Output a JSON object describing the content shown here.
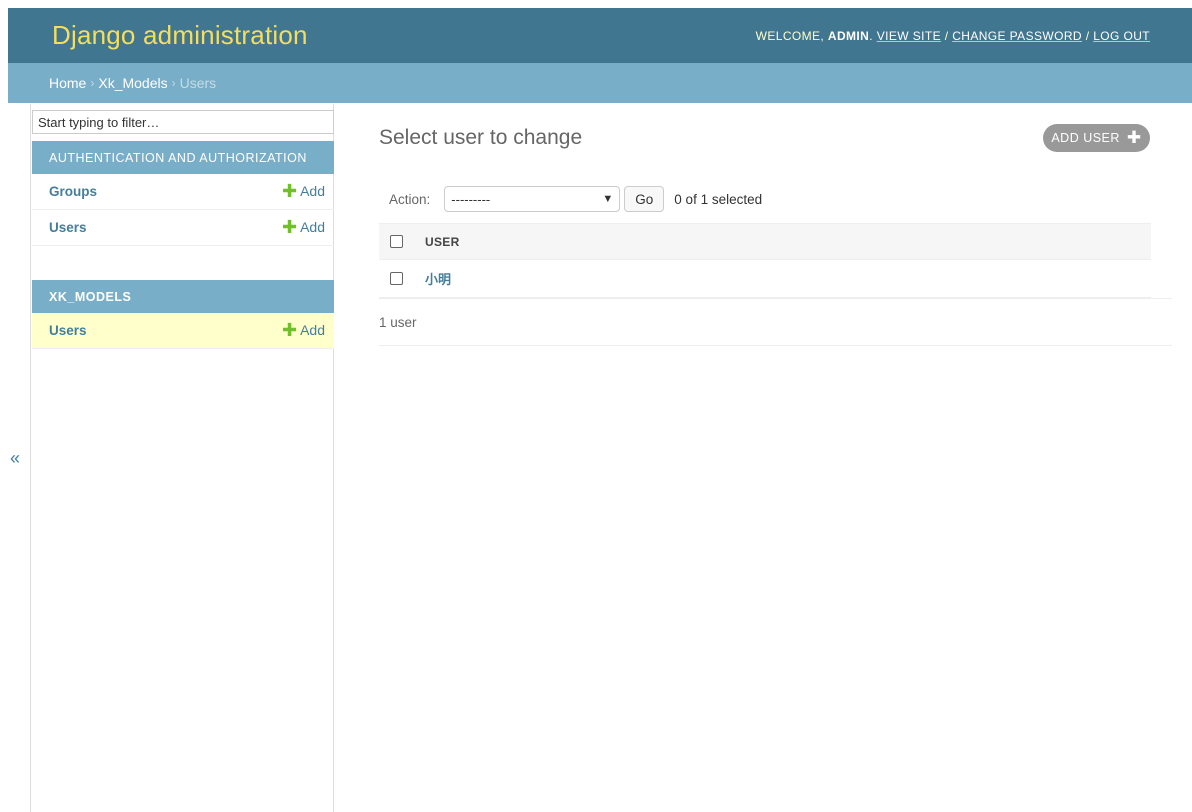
{
  "header": {
    "site_name": "Django administration",
    "welcome": "Welcome,",
    "username": "admin",
    "view_site": "View site",
    "change_password": "Change password",
    "log_out": "Log out",
    "separator": "/"
  },
  "breadcrumbs": {
    "home": "Home",
    "app": "Xk_Models",
    "current": "Users",
    "separator": "›"
  },
  "toggle_nav": {
    "label": "«"
  },
  "sidebar": {
    "filter_placeholder": "Start typing to filter…",
    "modules": [
      {
        "caption": "Authentication and Authorization",
        "items": [
          {
            "label": "Groups",
            "add_label": "Add"
          },
          {
            "label": "Users",
            "add_label": "Add"
          }
        ]
      },
      {
        "caption": "Xk_Models",
        "items": [
          {
            "label": "Users",
            "add_label": "Add",
            "current": true
          }
        ]
      }
    ]
  },
  "content": {
    "title": "Select user to change",
    "add_button": "Add user",
    "actions": {
      "label": "Action:",
      "selected_option": "---------",
      "go": "Go",
      "counter": "0 of 1 selected"
    },
    "table": {
      "columns": [
        "User"
      ],
      "rows": [
        {
          "user": "小明"
        }
      ]
    },
    "paginator": "1 user"
  },
  "colors": {
    "header_bg": "#417690",
    "site_name": "#f5dd5d",
    "breadcrumbs_bg": "#79aec8",
    "link": "#447e9b",
    "add_plus": "#70bf2b",
    "current_row_bg": "#ffffcc"
  }
}
